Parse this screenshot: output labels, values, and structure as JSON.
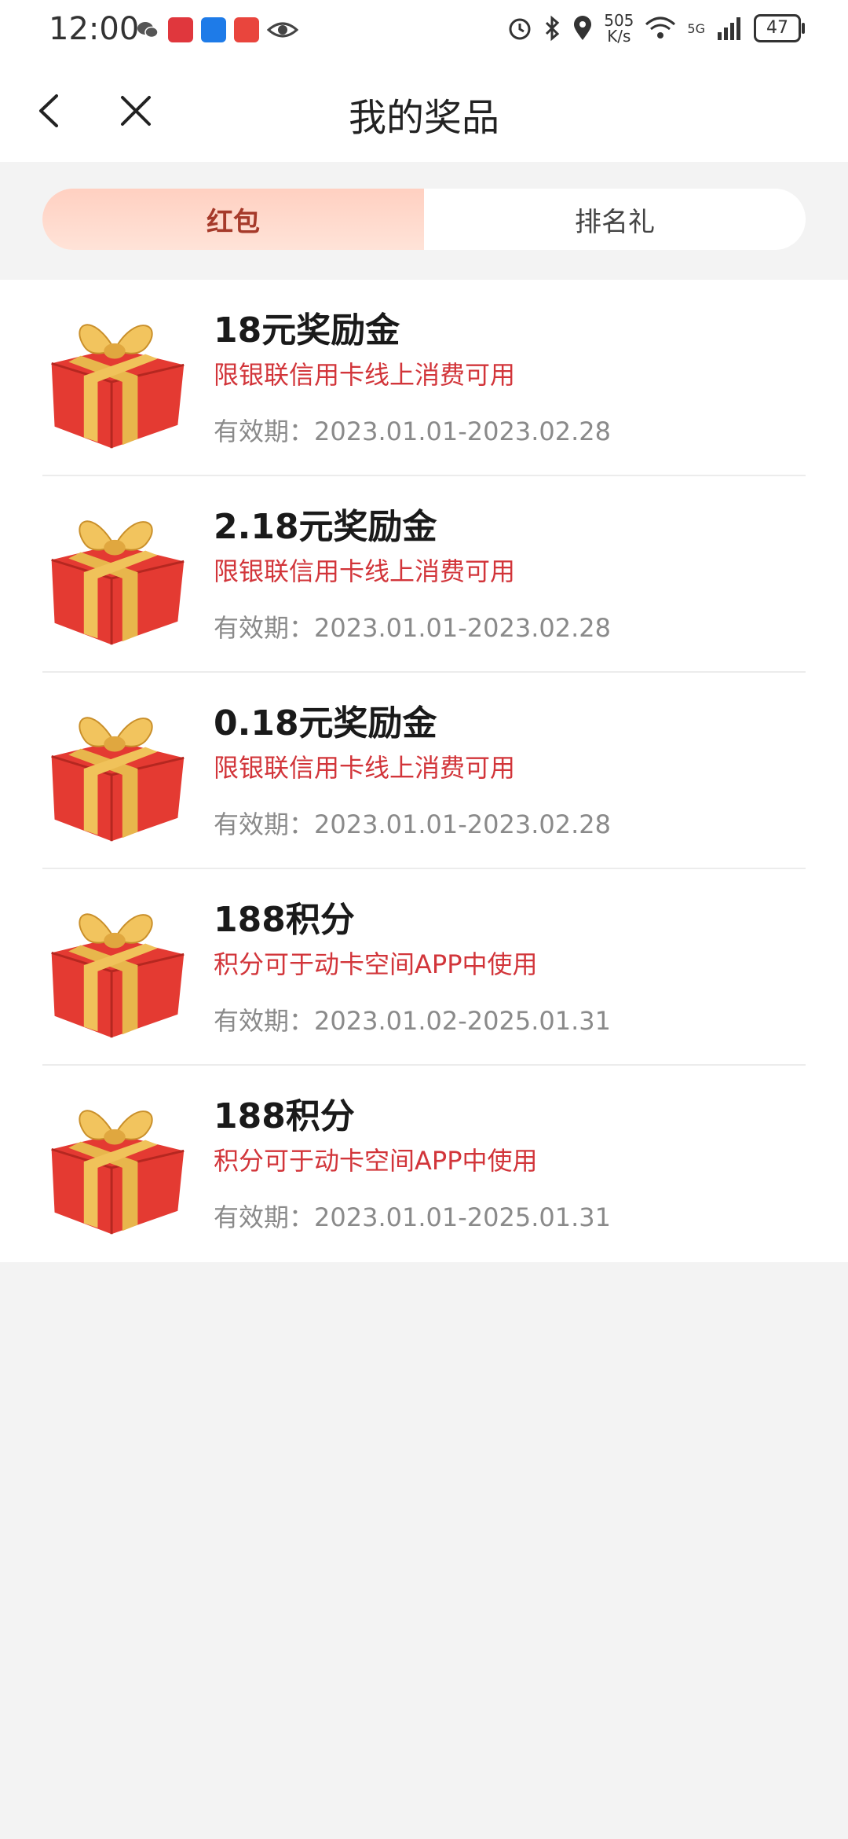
{
  "status_bar": {
    "time": "12:00",
    "net_speed_value": "505",
    "net_speed_unit": "K/s",
    "network": "5G",
    "battery": "47",
    "icons": [
      "wechat-icon",
      "app-icon",
      "maps-icon",
      "wallet-icon",
      "eye-icon",
      "alarm-icon",
      "bluetooth-icon",
      "location-icon",
      "wifi-icon",
      "signal-icon",
      "battery-icon"
    ]
  },
  "navbar": {
    "title": "我的奖品",
    "back_icon": "chevron-left-icon",
    "close_icon": "close-icon"
  },
  "tabs": [
    {
      "label": "红包",
      "active": true
    },
    {
      "label": "排名礼",
      "active": false
    }
  ],
  "prizes": [
    {
      "title": "18元奖励金",
      "desc": "限银联信用卡线上消费可用",
      "valid": "有效期：2023.01.01-2023.02.28"
    },
    {
      "title": "2.18元奖励金",
      "desc": "限银联信用卡线上消费可用",
      "valid": "有效期：2023.01.01-2023.02.28"
    },
    {
      "title": "0.18元奖励金",
      "desc": "限银联信用卡线上消费可用",
      "valid": "有效期：2023.01.01-2023.02.28"
    },
    {
      "title": "188积分",
      "desc": "积分可于动卡空间APP中使用",
      "valid": "有效期：2023.01.02-2025.01.31"
    },
    {
      "title": "188积分",
      "desc": "积分可于动卡空间APP中使用",
      "valid": "有效期：2023.01.01-2025.01.31"
    }
  ],
  "colors": {
    "accent_red": "#d2353a",
    "tab_active_text": "#a63a2a",
    "tab_active_bg": "#ffd7c9",
    "background": "#f3f3f3"
  }
}
